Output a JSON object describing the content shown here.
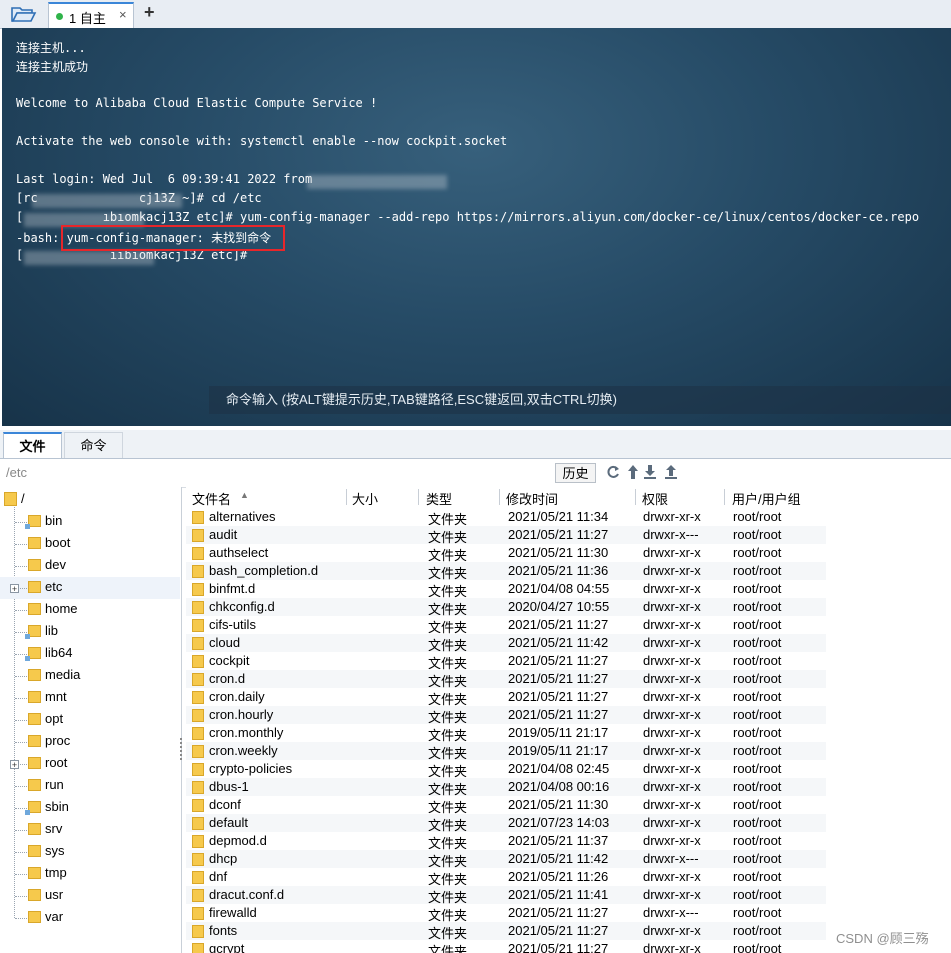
{
  "top_tabs": {
    "session_label": "1 自主",
    "close_glyph": "×",
    "add_glyph": "+"
  },
  "terminal": {
    "lines": [
      "连接主机...",
      "连接主机成功",
      "",
      "Welcome to Alibaba Cloud Elastic Compute Service !",
      "",
      "Activate the web console with: systemctl enable --now cockpit.socket",
      "",
      "Last login: Wed Jul  6 09:39:41 2022 from",
      "[rc              cj13Z ~]# cd /etc",
      "[           ıbıomkacj13Z etc]# yum-config-manager --add-repo https://mirrors.aliyun.com/docker-ce/linux/centos/docker-ce.repo",
      "-bash: yum-config-manager: 未找到命令",
      "[            ııbıomkacj13Z etc]#"
    ],
    "command_bar_hint": "命令输入 (按ALT键提示历史,TAB键路径,ESC键返回,双击CTRL切换)"
  },
  "lower_tabs": {
    "file": "文件",
    "command": "命令"
  },
  "path_bar": {
    "path": "/etc",
    "history_label": "历史"
  },
  "tree": {
    "root": "/",
    "items": [
      "bin",
      "boot",
      "dev",
      "etc",
      "home",
      "lib",
      "lib64",
      "media",
      "mnt",
      "opt",
      "proc",
      "root",
      "run",
      "sbin",
      "srv",
      "sys",
      "tmp",
      "usr",
      "var"
    ]
  },
  "file_table": {
    "headers": [
      "文件名",
      "大小",
      "类型",
      "修改时间",
      "权限",
      "用户/用户组"
    ],
    "sort_glyph": "▲",
    "rows": [
      [
        "alternatives",
        "",
        "文件夹",
        "2021/05/21 11:34",
        "drwxr-xr-x",
        "root/root"
      ],
      [
        "audit",
        "",
        "文件夹",
        "2021/05/21 11:27",
        "drwxr-x---",
        "root/root"
      ],
      [
        "authselect",
        "",
        "文件夹",
        "2021/05/21 11:30",
        "drwxr-xr-x",
        "root/root"
      ],
      [
        "bash_completion.d",
        "",
        "文件夹",
        "2021/05/21 11:36",
        "drwxr-xr-x",
        "root/root"
      ],
      [
        "binfmt.d",
        "",
        "文件夹",
        "2021/04/08 04:55",
        "drwxr-xr-x",
        "root/root"
      ],
      [
        "chkconfig.d",
        "",
        "文件夹",
        "2020/04/27 10:55",
        "drwxr-xr-x",
        "root/root"
      ],
      [
        "cifs-utils",
        "",
        "文件夹",
        "2021/05/21 11:27",
        "drwxr-xr-x",
        "root/root"
      ],
      [
        "cloud",
        "",
        "文件夹",
        "2021/05/21 11:42",
        "drwxr-xr-x",
        "root/root"
      ],
      [
        "cockpit",
        "",
        "文件夹",
        "2021/05/21 11:27",
        "drwxr-xr-x",
        "root/root"
      ],
      [
        "cron.d",
        "",
        "文件夹",
        "2021/05/21 11:27",
        "drwxr-xr-x",
        "root/root"
      ],
      [
        "cron.daily",
        "",
        "文件夹",
        "2021/05/21 11:27",
        "drwxr-xr-x",
        "root/root"
      ],
      [
        "cron.hourly",
        "",
        "文件夹",
        "2021/05/21 11:27",
        "drwxr-xr-x",
        "root/root"
      ],
      [
        "cron.monthly",
        "",
        "文件夹",
        "2019/05/11 21:17",
        "drwxr-xr-x",
        "root/root"
      ],
      [
        "cron.weekly",
        "",
        "文件夹",
        "2019/05/11 21:17",
        "drwxr-xr-x",
        "root/root"
      ],
      [
        "crypto-policies",
        "",
        "文件夹",
        "2021/04/08 02:45",
        "drwxr-xr-x",
        "root/root"
      ],
      [
        "dbus-1",
        "",
        "文件夹",
        "2021/04/08 00:16",
        "drwxr-xr-x",
        "root/root"
      ],
      [
        "dconf",
        "",
        "文件夹",
        "2021/05/21 11:30",
        "drwxr-xr-x",
        "root/root"
      ],
      [
        "default",
        "",
        "文件夹",
        "2021/07/23 14:03",
        "drwxr-xr-x",
        "root/root"
      ],
      [
        "depmod.d",
        "",
        "文件夹",
        "2021/05/21 11:37",
        "drwxr-xr-x",
        "root/root"
      ],
      [
        "dhcp",
        "",
        "文件夹",
        "2021/05/21 11:42",
        "drwxr-x---",
        "root/root"
      ],
      [
        "dnf",
        "",
        "文件夹",
        "2021/05/21 11:26",
        "drwxr-xr-x",
        "root/root"
      ],
      [
        "dracut.conf.d",
        "",
        "文件夹",
        "2021/05/21 11:41",
        "drwxr-xr-x",
        "root/root"
      ],
      [
        "firewalld",
        "",
        "文件夹",
        "2021/05/21 11:27",
        "drwxr-x---",
        "root/root"
      ],
      [
        "fonts",
        "",
        "文件夹",
        "2021/05/21 11:27",
        "drwxr-xr-x",
        "root/root"
      ],
      [
        "gcrypt",
        "",
        "文件夹",
        "2021/05/21 11:27",
        "drwxr-xr-x",
        "root/root"
      ]
    ]
  },
  "watermark": "CSDN @顾三殇"
}
